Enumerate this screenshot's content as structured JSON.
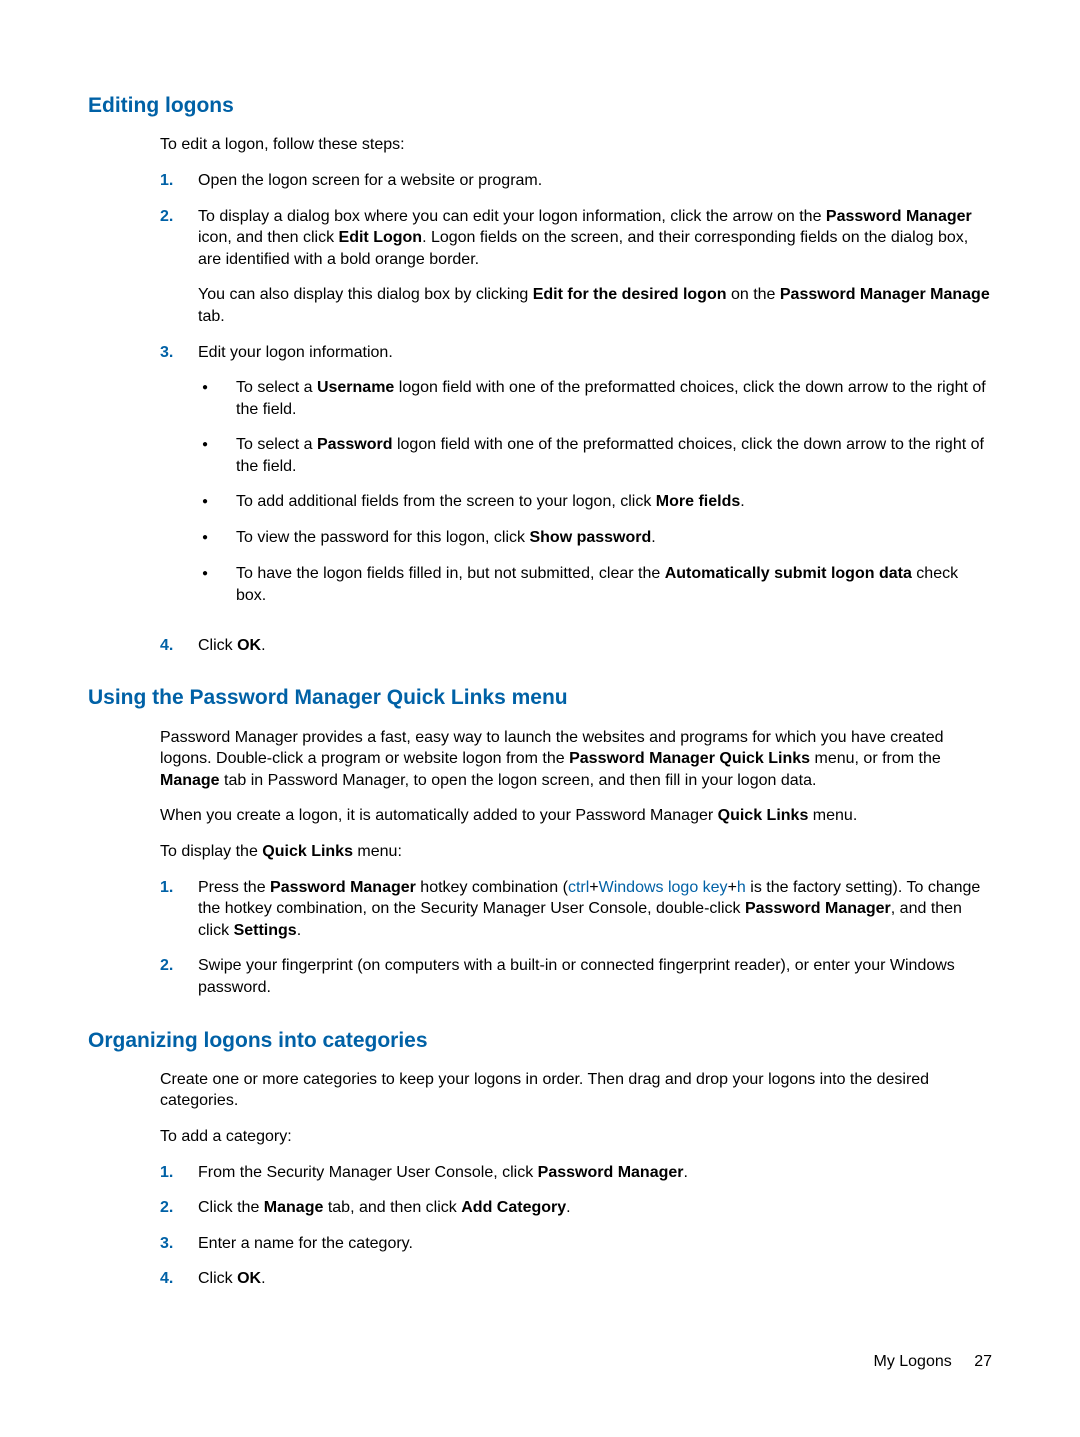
{
  "section1": {
    "heading": "Editing logons",
    "intro": "To edit a logon, follow these steps:",
    "items": [
      {
        "marker": "1.",
        "paras": [
          {
            "runs": [
              {
                "t": "Open the logon screen for a website or program."
              }
            ]
          }
        ]
      },
      {
        "marker": "2.",
        "paras": [
          {
            "runs": [
              {
                "t": "To display a dialog box where you can edit your logon information, click the arrow on the "
              },
              {
                "t": "Password Manager",
                "b": true
              },
              {
                "t": " icon, and then click "
              },
              {
                "t": "Edit Logon",
                "b": true
              },
              {
                "t": ". Logon fields on the screen, and their corresponding fields on the dialog box, are identified with a bold orange border."
              }
            ]
          },
          {
            "runs": [
              {
                "t": "You can also display this dialog box by clicking "
              },
              {
                "t": "Edit for the desired logon",
                "b": true
              },
              {
                "t": " on the "
              },
              {
                "t": "Password Manager Manage",
                "b": true
              },
              {
                "t": " tab."
              }
            ]
          }
        ]
      },
      {
        "marker": "3.",
        "paras": [
          {
            "runs": [
              {
                "t": "Edit your logon information."
              }
            ]
          }
        ],
        "bullets": [
          {
            "runs": [
              {
                "t": "To select a "
              },
              {
                "t": "Username",
                "b": true
              },
              {
                "t": " logon field with one of the preformatted choices, click the down arrow to the right of the field."
              }
            ]
          },
          {
            "runs": [
              {
                "t": "To select a "
              },
              {
                "t": "Password",
                "b": true
              },
              {
                "t": " logon field with one of the preformatted choices, click the down arrow to the right of the field."
              }
            ]
          },
          {
            "runs": [
              {
                "t": "To add additional fields from the screen to your logon, click "
              },
              {
                "t": "More fields",
                "b": true
              },
              {
                "t": "."
              }
            ]
          },
          {
            "runs": [
              {
                "t": "To view the password for this logon, click "
              },
              {
                "t": "Show password",
                "b": true
              },
              {
                "t": "."
              }
            ]
          },
          {
            "runs": [
              {
                "t": "To have the logon fields filled in, but not submitted, clear the "
              },
              {
                "t": "Automatically submit logon data",
                "b": true
              },
              {
                "t": " check box."
              }
            ]
          }
        ]
      },
      {
        "marker": "4.",
        "paras": [
          {
            "runs": [
              {
                "t": "Click "
              },
              {
                "t": "OK",
                "b": true
              },
              {
                "t": "."
              }
            ]
          }
        ]
      }
    ]
  },
  "section2": {
    "heading": "Using the Password Manager Quick Links menu",
    "paras": [
      {
        "runs": [
          {
            "t": "Password Manager provides a fast, easy way to launch the websites and programs for which you have created logons. Double-click a program or website logon from the "
          },
          {
            "t": "Password Manager Quick Links",
            "b": true
          },
          {
            "t": " menu, or from the "
          },
          {
            "t": "Manage",
            "b": true
          },
          {
            "t": " tab in Password Manager, to open the logon screen, and then fill in your logon data."
          }
        ]
      },
      {
        "runs": [
          {
            "t": "When you create a logon, it is automatically added to your Password Manager "
          },
          {
            "t": "Quick Links",
            "b": true
          },
          {
            "t": " menu."
          }
        ]
      },
      {
        "runs": [
          {
            "t": "To display the "
          },
          {
            "t": "Quick Links",
            "b": true
          },
          {
            "t": " menu:"
          }
        ]
      }
    ],
    "items": [
      {
        "marker": "1.",
        "paras": [
          {
            "runs": [
              {
                "t": "Press the "
              },
              {
                "t": "Password Manager",
                "b": true
              },
              {
                "t": " hotkey combination ("
              },
              {
                "t": "ctrl",
                "link": true
              },
              {
                "t": "+"
              },
              {
                "t": "Windows logo key",
                "link": true
              },
              {
                "t": "+"
              },
              {
                "t": "h",
                "link": true
              },
              {
                "t": " is the factory setting). To change the hotkey combination, on the Security Manager User Console, double-click "
              },
              {
                "t": "Password Manager",
                "b": true
              },
              {
                "t": ", and then click "
              },
              {
                "t": "Settings",
                "b": true
              },
              {
                "t": "."
              }
            ]
          }
        ]
      },
      {
        "marker": "2.",
        "paras": [
          {
            "runs": [
              {
                "t": "Swipe your fingerprint (on computers with a built-in or connected fingerprint reader), or enter your Windows password."
              }
            ]
          }
        ]
      }
    ]
  },
  "section3": {
    "heading": "Organizing logons into categories",
    "paras": [
      {
        "runs": [
          {
            "t": "Create one or more categories to keep your logons in order. Then drag and drop your logons into the desired categories."
          }
        ]
      },
      {
        "runs": [
          {
            "t": "To add a category:"
          }
        ]
      }
    ],
    "items": [
      {
        "marker": "1.",
        "paras": [
          {
            "runs": [
              {
                "t": "From the Security Manager User Console, click "
              },
              {
                "t": "Password Manager",
                "b": true
              },
              {
                "t": "."
              }
            ]
          }
        ]
      },
      {
        "marker": "2.",
        "paras": [
          {
            "runs": [
              {
                "t": "Click the "
              },
              {
                "t": "Manage",
                "b": true
              },
              {
                "t": " tab, and then click "
              },
              {
                "t": "Add Category",
                "b": true
              },
              {
                "t": "."
              }
            ]
          }
        ]
      },
      {
        "marker": "3.",
        "paras": [
          {
            "runs": [
              {
                "t": "Enter a name for the category."
              }
            ]
          }
        ]
      },
      {
        "marker": "4.",
        "paras": [
          {
            "runs": [
              {
                "t": "Click "
              },
              {
                "t": "OK",
                "b": true
              },
              {
                "t": "."
              }
            ]
          }
        ]
      }
    ]
  },
  "footer": {
    "section": "My Logons",
    "page": "27"
  }
}
